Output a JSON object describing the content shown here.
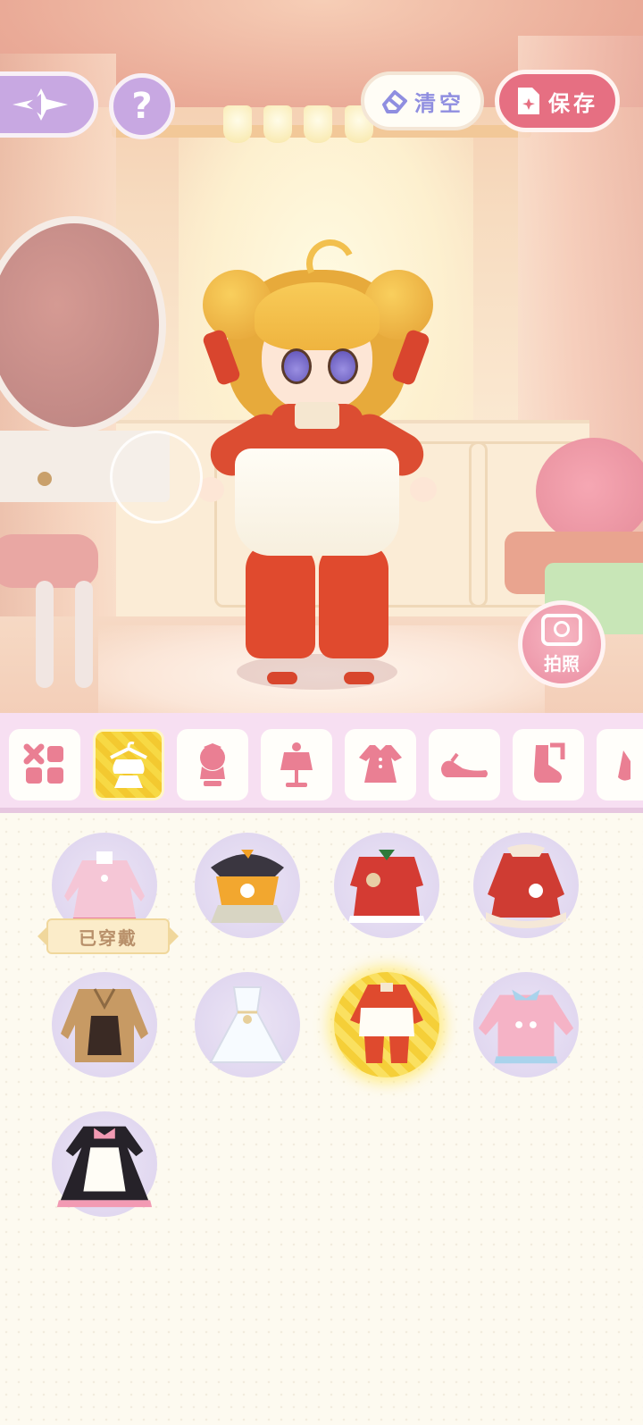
{
  "header": {
    "clear_label": "清空",
    "save_label": "保存",
    "help_label": "?",
    "photo_label": "拍照"
  },
  "colors": {
    "accent_purple": "#c8a8e2",
    "save_pink": "#e66f82",
    "tab_icon_pink": "#ea7f93",
    "selected_yellow": "#f7d944",
    "clear_text": "#8f8ee0"
  },
  "tabs": [
    {
      "icon": "all-categories-icon",
      "active": false
    },
    {
      "icon": "outfit-set-icon",
      "active": true
    },
    {
      "icon": "hairstyle-icon",
      "active": false
    },
    {
      "icon": "top-icon",
      "active": false
    },
    {
      "icon": "dress-icon",
      "active": false
    },
    {
      "icon": "shoes-icon",
      "active": false
    },
    {
      "icon": "socks-icon",
      "active": false
    },
    {
      "icon": "accessory-icon",
      "active": false
    }
  ],
  "outfits": [
    {
      "icon": "pink-dress-outfit-icon",
      "worn": true,
      "selected": false
    },
    {
      "icon": "orange-witch-outfit-icon",
      "worn": false,
      "selected": false
    },
    {
      "icon": "red-christmas-dress-icon",
      "worn": false,
      "selected": false
    },
    {
      "icon": "red-winter-coat-dress-icon",
      "worn": false,
      "selected": false
    },
    {
      "icon": "brown-trench-coat-icon",
      "worn": false,
      "selected": false
    },
    {
      "icon": "white-gown-icon",
      "worn": false,
      "selected": false
    },
    {
      "icon": "red-qipao-apron-outfit-icon",
      "worn": false,
      "selected": true
    },
    {
      "icon": "pink-sweater-icon",
      "worn": false,
      "selected": false
    },
    {
      "icon": "black-maid-dress-icon",
      "worn": false,
      "selected": false
    }
  ],
  "worn_badge": "已穿戴"
}
